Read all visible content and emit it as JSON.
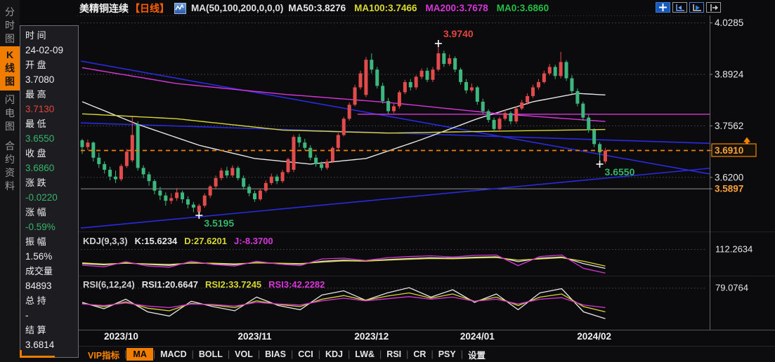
{
  "window_title": "美精铜连续 日线 K线图",
  "title_bar": {
    "symbol": "美精铜连续",
    "period": "【日线】",
    "ma_params": "MA(50,100,200,0,0,0)",
    "ma_values": [
      {
        "text": "MA50:3.8276",
        "color": "#e8e8e8"
      },
      {
        "text": "MA100:3.7466",
        "color": "#d8d832"
      },
      {
        "text": "MA200:3.7678",
        "color": "#d836d8"
      },
      {
        "text": "MA0:3.6860",
        "color": "#22c044"
      }
    ]
  },
  "toolbar_icons": [
    {
      "name": "pan-crosshair-icon"
    },
    {
      "name": "axis-left-icon"
    },
    {
      "name": "axis-play-icon"
    },
    {
      "name": "shift-right-icon"
    }
  ],
  "left_tabs": [
    {
      "label": "分时图",
      "selected": false
    },
    {
      "label": "K线图",
      "selected": true
    },
    {
      "label": "闪电图",
      "selected": false
    },
    {
      "label": "合约资料",
      "selected": false
    }
  ],
  "info_panel": {
    "rows": [
      {
        "label": "时 间",
        "value": "24-02-09",
        "color": "#ededed"
      },
      {
        "label": "开 盘",
        "value": "3.7080",
        "color": "#ededed"
      },
      {
        "label": "最 高",
        "value": "3.7130",
        "color": "#e2453f"
      },
      {
        "label": "最 低",
        "value": "3.6550",
        "color": "#35b56a"
      },
      {
        "label": "收 盘",
        "value": "3.6860",
        "color": "#35b56a"
      },
      {
        "label": "涨 跌",
        "value": "-0.0220",
        "color": "#35b56a"
      },
      {
        "label": "涨 幅",
        "value": "-0.59%",
        "color": "#35b56a"
      },
      {
        "label": "振 幅",
        "value": "1.56%",
        "color": "#ededed"
      },
      {
        "label": "成交量",
        "value": "84893",
        "color": "#ededed"
      },
      {
        "label": "总 持",
        "value": "-",
        "color": "#ededed"
      },
      {
        "label": "结 算",
        "value": "3.6814",
        "color": "#ededed"
      }
    ]
  },
  "bottom_tabs": [
    {
      "label": "VIP指标",
      "style": "vip"
    },
    {
      "label": "MA",
      "style": "sel"
    },
    {
      "label": "MACD",
      "style": ""
    },
    {
      "label": "BOLL",
      "style": ""
    },
    {
      "label": "VOL",
      "style": ""
    },
    {
      "label": "BIAS",
      "style": ""
    },
    {
      "label": "CCI",
      "style": ""
    },
    {
      "label": "KDJ",
      "style": ""
    },
    {
      "label": "LW&",
      "style": ""
    },
    {
      "label": "RSI",
      "style": ""
    },
    {
      "label": "CR",
      "style": ""
    },
    {
      "label": "PSY",
      "style": ""
    },
    {
      "label": "设置",
      "style": ""
    }
  ],
  "chart_data": {
    "type": "candlestick",
    "title": "美精铜连续 日线",
    "price_axis_labels": [
      {
        "text": "4.0285",
        "price": 4.0285,
        "style": "plain"
      },
      {
        "text": "3.8924",
        "price": 3.8924,
        "style": "plain"
      },
      {
        "text": "3.7562",
        "price": 3.7562,
        "style": "plain"
      },
      {
        "text": "3.6910",
        "price": 3.691,
        "style": "price-box"
      },
      {
        "text": "3.6200",
        "price": 3.62,
        "style": "plain"
      },
      {
        "text": "3.5897",
        "price": 3.5897,
        "style": "orange"
      }
    ],
    "gridline_prices": [
      4.0285,
      3.8924,
      3.7562,
      3.62
    ],
    "current_price_line": 3.691,
    "horizontal_gray_line": 3.5897,
    "x_labels": [
      {
        "text": "2023/10",
        "i": 7
      },
      {
        "text": "2023/11",
        "i": 31
      },
      {
        "text": "2023/12",
        "i": 52
      },
      {
        "text": "2024/01",
        "i": 71
      },
      {
        "text": "2024/02",
        "i": 92
      }
    ],
    "annotations": [
      {
        "text": "3.9740",
        "i": 64,
        "price": 3.974,
        "color": "#e2453f",
        "pos": "above"
      },
      {
        "text": "3.5195",
        "i": 21,
        "price": 3.5195,
        "color": "#35b56a",
        "pos": "below"
      },
      {
        "text": "3.6550",
        "i": 93,
        "price": 3.655,
        "color": "#35b56a",
        "pos": "below"
      }
    ],
    "candles_ohlc": [
      [
        3.718,
        3.722,
        3.682,
        3.7
      ],
      [
        3.7,
        3.72,
        3.692,
        3.712
      ],
      [
        3.712,
        3.715,
        3.662,
        3.672
      ],
      [
        3.672,
        3.685,
        3.645,
        3.655
      ],
      [
        3.655,
        3.662,
        3.63,
        3.64
      ],
      [
        3.64,
        3.648,
        3.612,
        3.622
      ],
      [
        3.622,
        3.638,
        3.605,
        3.615
      ],
      [
        3.615,
        3.655,
        3.61,
        3.65
      ],
      [
        3.65,
        3.695,
        3.645,
        3.688
      ],
      [
        3.665,
        3.78,
        3.66,
        3.732
      ],
      [
        3.76,
        3.768,
        3.638,
        3.645
      ],
      [
        3.645,
        3.652,
        3.618,
        3.628
      ],
      [
        3.628,
        3.635,
        3.598,
        3.61
      ],
      [
        3.61,
        3.615,
        3.575,
        3.585
      ],
      [
        3.585,
        3.595,
        3.56,
        3.572
      ],
      [
        3.572,
        3.58,
        3.545,
        3.558
      ],
      [
        3.558,
        3.578,
        3.55,
        3.565
      ],
      [
        3.565,
        3.592,
        3.558,
        3.58
      ],
      [
        3.58,
        3.585,
        3.552,
        3.562
      ],
      [
        3.562,
        3.57,
        3.538,
        3.548
      ],
      [
        3.548,
        3.555,
        3.528,
        3.54
      ],
      [
        3.528,
        3.55,
        3.5195,
        3.545
      ],
      [
        3.545,
        3.578,
        3.54,
        3.572
      ],
      [
        3.572,
        3.6,
        3.565,
        3.596
      ],
      [
        3.596,
        3.625,
        3.59,
        3.618
      ],
      [
        3.618,
        3.645,
        3.612,
        3.638
      ],
      [
        3.638,
        3.648,
        3.618,
        3.625
      ],
      [
        3.625,
        3.652,
        3.62,
        3.645
      ],
      [
        3.645,
        3.65,
        3.612,
        3.618
      ],
      [
        3.618,
        3.625,
        3.588,
        3.595
      ],
      [
        3.595,
        3.602,
        3.57,
        3.578
      ],
      [
        3.578,
        3.585,
        3.555,
        3.562
      ],
      [
        3.562,
        3.59,
        3.558,
        3.585
      ],
      [
        3.585,
        3.612,
        3.58,
        3.605
      ],
      [
        3.605,
        3.63,
        3.6,
        3.622
      ],
      [
        3.622,
        3.628,
        3.602,
        3.61
      ],
      [
        3.61,
        3.64,
        3.605,
        3.634
      ],
      [
        3.634,
        3.672,
        3.63,
        3.668
      ],
      [
        3.64,
        3.732,
        3.634,
        3.727
      ],
      [
        3.727,
        3.735,
        3.7,
        3.712
      ],
      [
        3.712,
        3.722,
        3.692,
        3.698
      ],
      [
        3.698,
        3.705,
        3.665,
        3.672
      ],
      [
        3.672,
        3.68,
        3.648,
        3.655
      ],
      [
        3.655,
        3.662,
        3.638,
        3.645
      ],
      [
        3.645,
        3.668,
        3.64,
        3.662
      ],
      [
        3.662,
        3.702,
        3.658,
        3.698
      ],
      [
        3.698,
        3.738,
        3.692,
        3.732
      ],
      [
        3.732,
        3.78,
        3.728,
        3.775
      ],
      [
        3.775,
        3.818,
        3.77,
        3.812
      ],
      [
        3.812,
        3.865,
        3.808,
        3.858
      ],
      [
        3.858,
        3.902,
        3.852,
        3.895
      ],
      [
        3.838,
        3.938,
        3.832,
        3.931
      ],
      [
        3.931,
        3.948,
        3.895,
        3.905
      ],
      [
        3.905,
        3.912,
        3.855,
        3.862
      ],
      [
        3.862,
        3.87,
        3.815,
        3.822
      ],
      [
        3.822,
        3.83,
        3.788,
        3.795
      ],
      [
        3.795,
        3.815,
        3.79,
        3.808
      ],
      [
        3.808,
        3.85,
        3.802,
        3.845
      ],
      [
        3.845,
        3.878,
        3.84,
        3.872
      ],
      [
        3.872,
        3.88,
        3.85,
        3.858
      ],
      [
        3.858,
        3.89,
        3.852,
        3.886
      ],
      [
        3.886,
        3.908,
        3.88,
        3.902
      ],
      [
        3.902,
        3.91,
        3.872,
        3.878
      ],
      [
        3.878,
        3.912,
        3.872,
        3.905
      ],
      [
        3.905,
        3.974,
        3.9,
        3.948
      ],
      [
        3.948,
        3.955,
        3.912,
        3.92
      ],
      [
        3.92,
        3.945,
        3.915,
        3.935
      ],
      [
        3.935,
        3.94,
        3.898,
        3.905
      ],
      [
        3.905,
        3.91,
        3.865,
        3.872
      ],
      [
        3.872,
        3.88,
        3.842,
        3.85
      ],
      [
        3.85,
        3.868,
        3.845,
        3.858
      ],
      [
        3.858,
        3.862,
        3.812,
        3.82
      ],
      [
        3.82,
        3.828,
        3.788,
        3.795
      ],
      [
        3.795,
        3.8,
        3.765,
        3.772
      ],
      [
        3.772,
        3.778,
        3.74,
        3.748
      ],
      [
        3.748,
        3.78,
        3.742,
        3.775
      ],
      [
        3.775,
        3.798,
        3.77,
        3.79
      ],
      [
        3.79,
        3.795,
        3.76,
        3.768
      ],
      [
        3.768,
        3.808,
        3.762,
        3.802
      ],
      [
        3.802,
        3.825,
        3.798,
        3.818
      ],
      [
        3.818,
        3.842,
        3.812,
        3.835
      ],
      [
        3.835,
        3.865,
        3.83,
        3.858
      ],
      [
        3.858,
        3.88,
        3.852,
        3.872
      ],
      [
        3.872,
        3.902,
        3.868,
        3.895
      ],
      [
        3.895,
        3.92,
        3.89,
        3.912
      ],
      [
        3.912,
        3.918,
        3.88,
        3.888
      ],
      [
        3.888,
        3.952,
        3.882,
        3.925
      ],
      [
        3.925,
        3.93,
        3.875,
        3.882
      ],
      [
        3.882,
        3.89,
        3.84,
        3.848
      ],
      [
        3.848,
        3.855,
        3.808,
        3.815
      ],
      [
        3.815,
        3.82,
        3.77,
        3.778
      ],
      [
        3.778,
        3.785,
        3.738,
        3.745
      ],
      [
        3.745,
        3.75,
        3.7,
        3.708
      ],
      [
        3.708,
        3.713,
        3.655,
        3.686
      ],
      [
        3.662,
        3.698,
        3.656,
        3.691
      ]
    ],
    "moving_averages": [
      {
        "name": "MA50",
        "color": "#e6e6e6",
        "points": [
          [
            0,
            3.82
          ],
          [
            10,
            3.76
          ],
          [
            21,
            3.705
          ],
          [
            31,
            3.67
          ],
          [
            41,
            3.655
          ],
          [
            51,
            3.67
          ],
          [
            61,
            3.72
          ],
          [
            71,
            3.775
          ],
          [
            81,
            3.82
          ],
          [
            89,
            3.842
          ],
          [
            94,
            3.838
          ]
        ]
      },
      {
        "name": "MA100",
        "color": "#d8d832",
        "points": [
          [
            0,
            3.788
          ],
          [
            17,
            3.775
          ],
          [
            36,
            3.745
          ],
          [
            55,
            3.737
          ],
          [
            74,
            3.742
          ],
          [
            94,
            3.7466
          ]
        ]
      },
      {
        "name": "MA200",
        "color": "#d836d8",
        "points": [
          [
            0,
            3.91
          ],
          [
            17,
            3.868
          ],
          [
            36,
            3.84
          ],
          [
            55,
            3.818
          ],
          [
            75,
            3.788
          ],
          [
            94,
            3.7678
          ]
        ]
      }
    ],
    "magenta_ray": {
      "price": 3.787,
      "x1frac": 0.44,
      "x2frac": 1.0
    },
    "trendlines": [
      {
        "name": "descending-resistance",
        "color": "#2a2ae0",
        "p1": [
          0.0,
          3.9276
        ],
        "p2": [
          1.0,
          3.629
        ]
      },
      {
        "name": "ascending-support",
        "color": "#2a2ae0",
        "p1": [
          0.0,
          3.486
        ],
        "p2": [
          1.0,
          3.644
        ]
      },
      {
        "name": "flat-channel",
        "color": "#2a2ae0",
        "p1": [
          0.0,
          3.764
        ],
        "p2": [
          1.0,
          3.71
        ]
      }
    ],
    "kdj": {
      "label": [
        {
          "text": "KDJ(9,3,3)",
          "color": "#d0d0d0"
        },
        {
          "text": "K:15.6234",
          "color": "#e6e6e6"
        },
        {
          "text": "D:27.6201",
          "color": "#d8d832"
        },
        {
          "text": "J:-8.3700",
          "color": "#d836d8"
        }
      ],
      "gridline_value": 112.2634,
      "gridline_label": "112.2634",
      "series": [
        {
          "name": "K",
          "color": "#e6e6e6",
          "values": [
            40,
            34,
            44,
            36,
            31,
            45,
            40,
            35,
            46,
            41,
            37,
            52,
            58,
            54,
            61,
            66,
            70,
            68,
            73,
            75,
            50,
            68,
            74,
            40,
            16
          ]
        },
        {
          "name": "D",
          "color": "#d8d832",
          "values": [
            44,
            38,
            42,
            39,
            36,
            43,
            42,
            39,
            44,
            42,
            40,
            48,
            54,
            53,
            58,
            62,
            66,
            65,
            69,
            71,
            58,
            64,
            70,
            52,
            28
          ]
        },
        {
          "name": "J",
          "color": "#d836d8",
          "values": [
            32,
            24,
            50,
            28,
            22,
            52,
            36,
            28,
            52,
            38,
            30,
            64,
            68,
            56,
            70,
            76,
            80,
            74,
            82,
            84,
            30,
            76,
            84,
            16,
            -8
          ]
        }
      ]
    },
    "rsi": {
      "label": [
        {
          "text": "RSI(6,12,24)",
          "color": "#d0d0d0"
        },
        {
          "text": "RSI1:20.6647",
          "color": "#e6e6e6"
        },
        {
          "text": "RSI2:33.7245",
          "color": "#d8d832"
        },
        {
          "text": "RSI3:42.2282",
          "color": "#d836d8"
        }
      ],
      "gridline_value": 79.0764,
      "gridline_label": "79.0764",
      "series": [
        {
          "name": "RSI1",
          "color": "#e6e6e6",
          "values": [
            52,
            40,
            58,
            34,
            26,
            54,
            44,
            36,
            62,
            46,
            38,
            66,
            74,
            56,
            70,
            80,
            62,
            76,
            52,
            68,
            38,
            70,
            78,
            34,
            21
          ]
        },
        {
          "name": "RSI2",
          "color": "#d8d832",
          "values": [
            50,
            44,
            53,
            41,
            36,
            50,
            47,
            42,
            55,
            48,
            44,
            58,
            65,
            56,
            64,
            70,
            60,
            68,
            54,
            62,
            46,
            62,
            68,
            44,
            34
          ]
        },
        {
          "name": "RSI3",
          "color": "#d836d8",
          "values": [
            49,
            46,
            51,
            45,
            42,
            49,
            48,
            45,
            52,
            49,
            47,
            55,
            60,
            55,
            59,
            63,
            58,
            62,
            54,
            58,
            49,
            58,
            61,
            47,
            42
          ]
        }
      ]
    },
    "colors": {
      "up_candle": "#e24b4b",
      "down_candle": "#3eb77e",
      "grid": "#4c4c4c",
      "axis_text": "#e8e8e8",
      "accent_orange": "#f28500",
      "trend_blue": "#2a2ae0",
      "gray_line": "#909090"
    }
  }
}
